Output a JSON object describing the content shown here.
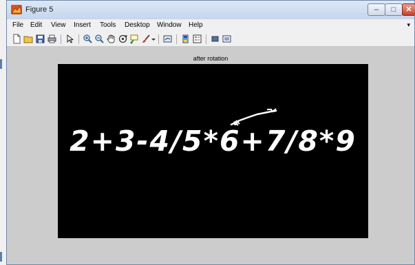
{
  "window": {
    "title": "Figure 5"
  },
  "menu": [
    {
      "label": "File"
    },
    {
      "label": "Edit"
    },
    {
      "label": "View"
    },
    {
      "label": "Insert"
    },
    {
      "label": "Tools"
    },
    {
      "label": "Desktop"
    },
    {
      "label": "Window"
    },
    {
      "label": "Help"
    }
  ],
  "toolbar_icons": [
    "new-figure-icon",
    "open-file-icon",
    "save-icon",
    "print-icon",
    "select-arrow-icon",
    "zoom-in-icon",
    "zoom-out-icon",
    "pan-hand-icon",
    "rotate-3d-icon",
    "data-cursor-icon",
    "brush-icon",
    "link-plot-icon",
    "colorbar-icon",
    "legend-icon",
    "hide-plot-tools-icon",
    "show-plot-tools-icon"
  ],
  "axes": {
    "title": "after rotation",
    "image_text": "2+3-4/5*6+7/8*9"
  },
  "colors": {
    "titlebar": "#c5d6ec",
    "figure_background": "#cccccc",
    "image_background": "#000000",
    "image_foreground": "#ffffff"
  }
}
